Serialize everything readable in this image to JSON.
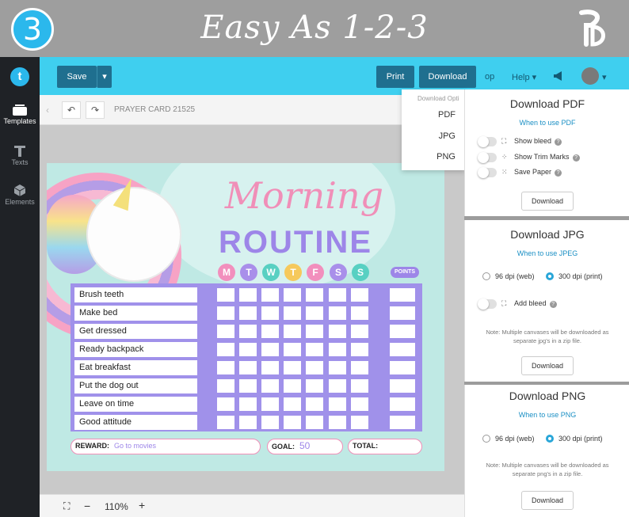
{
  "banner": {
    "step": "3",
    "title": "Easy As 1-2-3"
  },
  "sidebar": {
    "items": [
      {
        "label": "Templates"
      },
      {
        "label": "Texts"
      },
      {
        "label": "Elements"
      }
    ]
  },
  "toolbar": {
    "save_label": "Save",
    "print_label": "Print",
    "download_label": "Download",
    "op_label": "op",
    "help_label": "Help"
  },
  "subbar": {
    "document_name": "PRAYER CARD 21525"
  },
  "zoom": {
    "level": "110%"
  },
  "download_menu": {
    "header": "Download Opti",
    "options": [
      "PDF",
      "JPG",
      "PNG"
    ]
  },
  "chart_card": {
    "title_script": "Morning",
    "title_block": "ROUTINE",
    "days": [
      "M",
      "T",
      "W",
      "T",
      "F",
      "S",
      "S"
    ],
    "day_colors": [
      "#f28fbd",
      "#a98fea",
      "#58d0c2",
      "#f6c95c",
      "#f28fbd",
      "#a98fea",
      "#58d0c2"
    ],
    "points_label": "POINTS",
    "tasks": [
      "Brush teeth",
      "Make bed",
      "Get dressed",
      "Ready backpack",
      "Eat breakfast",
      "Put the dog out",
      "Leave on time",
      "Good attitude"
    ],
    "reward_label": "REWARD:",
    "reward_value": "Go to movies",
    "goal_label": "GOAL:",
    "goal_value": "50",
    "total_label": "TOTAL:"
  },
  "pdf_panel": {
    "title": "Download PDF",
    "link": "When to use PDF",
    "options": [
      "Show bleed",
      "Show Trim Marks",
      "Save Paper"
    ],
    "button": "Download"
  },
  "jpg_panel": {
    "title": "Download JPG",
    "link": "When to use JPEG",
    "dpi_web": "96 dpi (web)",
    "dpi_print": "300 dpi (print)",
    "bleed_label": "Add bleed",
    "note": "Note: Multiple canvases will be downloaded as separate jpg's in a zip file.",
    "button": "Download"
  },
  "png_panel": {
    "title": "Download PNG",
    "link": "When to use PNG",
    "dpi_web": "96 dpi (web)",
    "dpi_print": "300 dpi (print)",
    "note": "Note: Multiple canvases will be downloaded as separate png's in a zip file.",
    "button": "Download"
  }
}
